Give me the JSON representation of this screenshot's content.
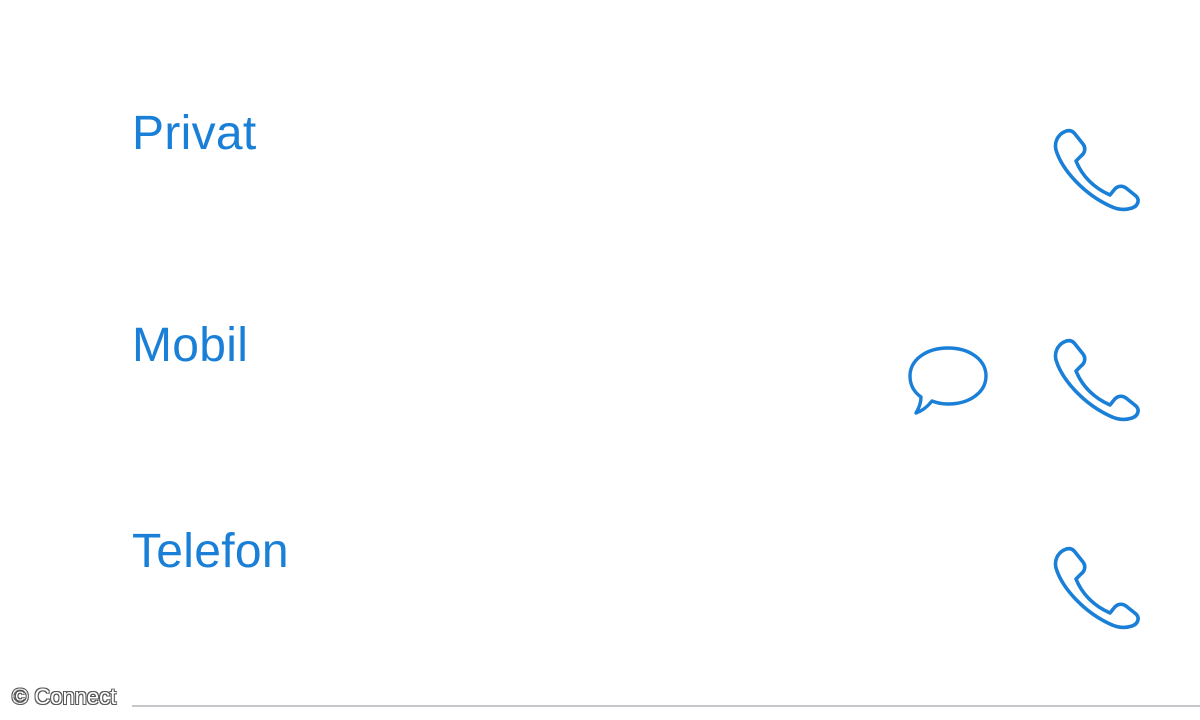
{
  "colors": {
    "accent": "#1a7fd7",
    "divider": "#c8c8cc",
    "background": "#ffffff"
  },
  "contacts": {
    "rows": [
      {
        "label": "Privat",
        "actions": [
          "phone-icon"
        ]
      },
      {
        "label": "Mobil",
        "actions": [
          "message-bubble-icon",
          "phone-icon"
        ]
      },
      {
        "label": "Telefon",
        "actions": [
          "phone-icon"
        ]
      }
    ]
  },
  "watermark": {
    "text": "© Connect"
  }
}
